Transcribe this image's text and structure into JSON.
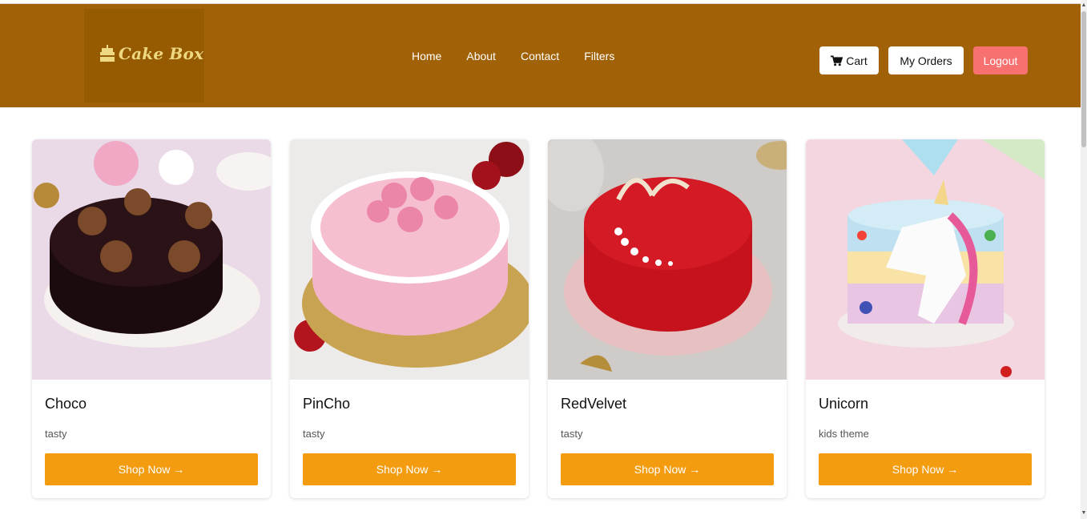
{
  "brand": {
    "name": "Cake Box",
    "icon": "cake-icon",
    "text_color": "#fde68a"
  },
  "colors": {
    "navbar": "#a16207",
    "accent": "#f39c0f",
    "logout": "#f87171"
  },
  "nav": {
    "items": [
      {
        "label": "Home"
      },
      {
        "label": "About"
      },
      {
        "label": "Contact"
      },
      {
        "label": "Filters"
      }
    ]
  },
  "actions": {
    "cart_label": "Cart",
    "cart_icon": "cart-icon",
    "orders_label": "My Orders",
    "logout_label": "Logout"
  },
  "products": [
    {
      "name": "Choco",
      "description": "tasty",
      "button": "Shop Now →"
    },
    {
      "name": "PinCho",
      "description": "tasty",
      "button": "Shop Now →"
    },
    {
      "name": "RedVelvet",
      "description": "tasty",
      "button": "Shop Now →"
    },
    {
      "name": "Unicorn",
      "description": "kids theme",
      "button": "Shop Now →"
    }
  ]
}
